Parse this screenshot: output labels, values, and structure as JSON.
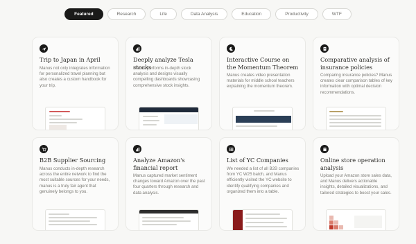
{
  "tabs": [
    "Featured",
    "Research",
    "Life",
    "Data Analysis",
    "Education",
    "Productivity",
    "WTF"
  ],
  "active_tab": "Featured",
  "cards": [
    {
      "title": "Trip to Japan in April",
      "description": "Manus not only integrates information for personalized travel planning but also creates a custom handbook for your trip.",
      "icon": "airplane-icon"
    },
    {
      "title": "Deeply analyze Tesla stocks",
      "description": "Manus performs in-depth stock analysis and designs visually compelling dashboards showcasing comprehensive stock insights.",
      "icon": "chart-icon"
    },
    {
      "title": "Interactive Course on the Momentum Theorem",
      "description": "Manus creates video presentation materials for middle school teachers explaining the momentum theorem.",
      "icon": "moon-icon"
    },
    {
      "title": "Comparative analysis of insurance policies",
      "description": "Comparing insurance policies? Manus creates clear comparison tables of key information with optimal decision recommendations.",
      "icon": "document-icon"
    },
    {
      "title": "B2B Supplier Sourcing",
      "description": "Manus conducts in-depth research across the entire network to find the most suitable sources for your needs, manus is a truly fair agent that genuinely belongs to you.",
      "icon": "cart-icon"
    },
    {
      "title": "Analyze Amazon's financial report",
      "description": "Manus captured market sentiment changes toward Amazon over the past four quarters through research and data analysis.",
      "icon": "chart-icon"
    },
    {
      "title": "List of YC Companies",
      "description": "We needed a list of all B2B companies from YC W25 batch, and Manus efficiently visited the YC website to identify qualifying companies and organized them into a table.",
      "icon": "table-icon"
    },
    {
      "title": "Online store operation analysis",
      "description": "Upload your Amazon store sales data, and Manus delivers actionable insights, detailed visualizations, and tailored strategies to boost your sales.",
      "icon": "store-icon"
    }
  ],
  "colors": {
    "accent": "#1a1a19",
    "page_bg": "#f7f7f5",
    "card_bg": "#fbfbfa"
  }
}
